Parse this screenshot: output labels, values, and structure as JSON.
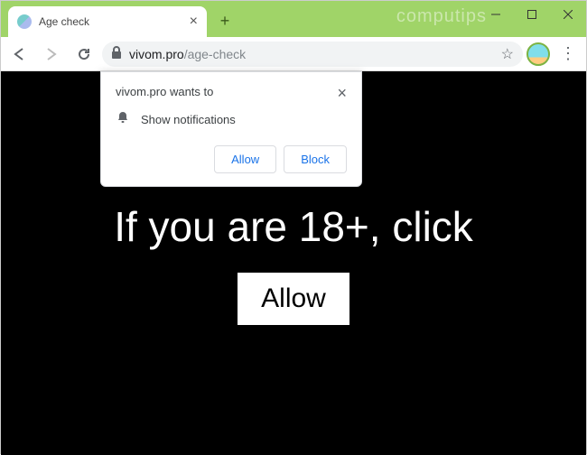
{
  "window": {
    "watermark": "computips"
  },
  "tab": {
    "title": "Age check"
  },
  "address": {
    "domain": "vivom.pro",
    "path": "/age-check"
  },
  "permission": {
    "host_wants": "vivom.pro wants to",
    "request": "Show notifications",
    "allow": "Allow",
    "block": "Block"
  },
  "page": {
    "headline": "If you are 18+, click",
    "allow_button": "Allow"
  }
}
